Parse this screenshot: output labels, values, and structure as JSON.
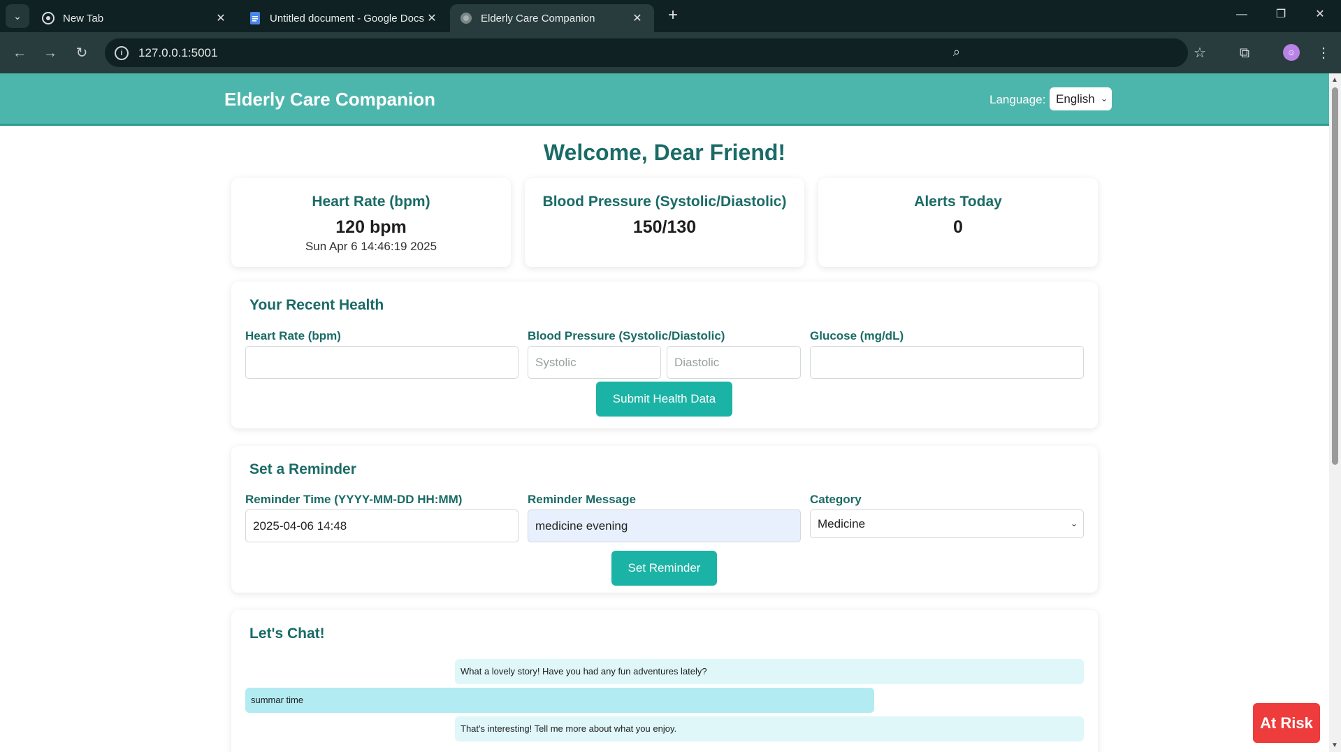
{
  "browser": {
    "tabs": [
      {
        "title": "New Tab",
        "icon": "chrome-icon"
      },
      {
        "title": "Untitled document - Google Docs",
        "icon": "docs-icon"
      },
      {
        "title": "Elderly Care Companion",
        "icon": "globe-icon"
      }
    ],
    "url": "127.0.0.1:5001"
  },
  "header": {
    "brand": "Elderly Care Companion",
    "language_label": "Language:",
    "language_value": "English"
  },
  "welcome": "Welcome, Dear Friend!",
  "stats": [
    {
      "title": "Heart Rate (bpm)",
      "value": "120 bpm",
      "sub": "Sun Apr 6 14:46:19 2025"
    },
    {
      "title": "Blood Pressure (Systolic/Diastolic)",
      "value": "150/130",
      "sub": ""
    },
    {
      "title": "Alerts Today",
      "value": "0",
      "sub": ""
    }
  ],
  "health_form": {
    "title": "Your Recent Health",
    "heart_label": "Heart Rate (bpm)",
    "bp_label": "Blood Pressure (Systolic/Diastolic)",
    "systolic_placeholder": "Systolic",
    "diastolic_placeholder": "Diastolic",
    "glucose_label": "Glucose (mg/dL)",
    "submit_label": "Submit Health Data"
  },
  "reminder_form": {
    "title": "Set a Reminder",
    "time_label": "Reminder Time (YYYY-MM-DD HH:MM)",
    "time_value": "2025-04-06 14:48",
    "message_label": "Reminder Message",
    "message_value": "medicine evening",
    "category_label": "Category",
    "category_value": "Medicine",
    "submit_label": "Set Reminder"
  },
  "chat": {
    "title": "Let's Chat!",
    "messages": [
      {
        "from": "bot",
        "text": "What a lovely story! Have you had any fun adventures lately?"
      },
      {
        "from": "user",
        "text": "summar time"
      },
      {
        "from": "bot",
        "text": "That's interesting! Tell me more about what you enjoy."
      }
    ]
  },
  "risk_badge": "At Risk",
  "colors": {
    "header": "#4db6ac",
    "accent": "#1bb3a5",
    "title": "#1a6b66",
    "risk": "#ee3b3b"
  }
}
